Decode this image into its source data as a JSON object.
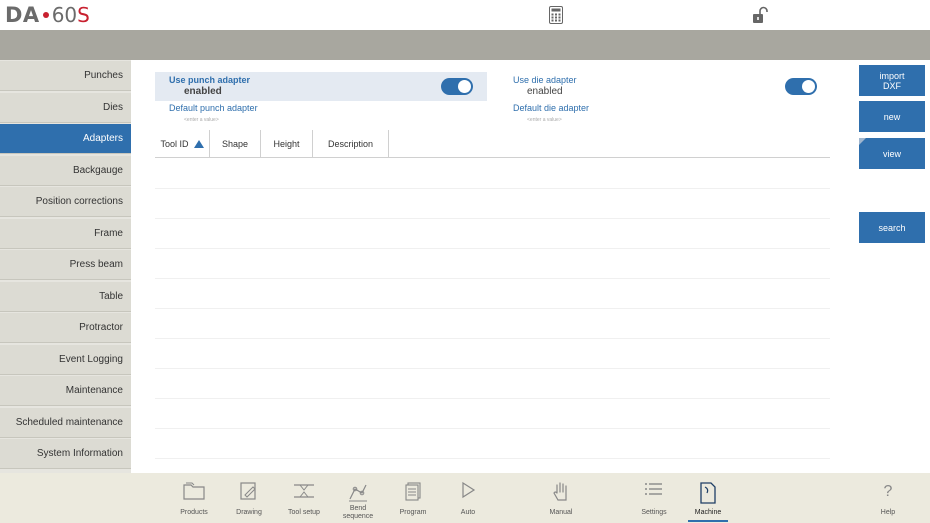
{
  "header": {
    "logo_brand": "DA",
    "logo_model_prefix": "60",
    "logo_model_suffix": "S"
  },
  "sidebar": {
    "items": [
      {
        "label": "Punches",
        "active": false
      },
      {
        "label": "Dies",
        "active": false
      },
      {
        "label": "Adapters",
        "active": true
      },
      {
        "label": "Backgauge",
        "active": false
      },
      {
        "label": "Position corrections",
        "active": false
      },
      {
        "label": "Frame",
        "active": false
      },
      {
        "label": "Press beam",
        "active": false
      },
      {
        "label": "Table",
        "active": false
      },
      {
        "label": "Protractor",
        "active": false
      },
      {
        "label": "Event Logging",
        "active": false
      },
      {
        "label": "Maintenance",
        "active": false
      },
      {
        "label": "Scheduled maintenance",
        "active": false
      },
      {
        "label": "System Information",
        "active": false
      }
    ]
  },
  "options": {
    "use_punch_adapter": {
      "label": "Use punch adapter",
      "value": "enabled",
      "toggle_on": true
    },
    "use_die_adapter": {
      "label": "Use die adapter",
      "value": "enabled",
      "toggle_on": true
    },
    "default_punch_adapter": {
      "label": "Default punch adapter",
      "placeholder": "<enter a value>"
    },
    "default_die_adapter": {
      "label": "Default die adapter",
      "placeholder": "<enter a value>"
    }
  },
  "table": {
    "columns": [
      "Tool ID",
      "Shape",
      "Height",
      "Description"
    ],
    "sort_column": "Tool ID",
    "sort_direction": "ascending",
    "rows": []
  },
  "actions": {
    "import_dxf": "import\nDXF",
    "new": "new",
    "view": "view",
    "search": "search"
  },
  "bottom_nav": [
    {
      "label": "Products",
      "icon": "folder-icon",
      "active": false
    },
    {
      "label": "Drawing",
      "icon": "pencil-icon",
      "active": false
    },
    {
      "label": "Tool setup",
      "icon": "tool-setup-icon",
      "active": false
    },
    {
      "label": "Bend\nsequence",
      "icon": "bend-sequence-icon",
      "active": false
    },
    {
      "label": "Program",
      "icon": "program-icon",
      "active": false
    },
    {
      "label": "Auto",
      "icon": "play-icon",
      "active": false
    },
    {
      "label": "Manual",
      "icon": "hand-icon",
      "active": false
    },
    {
      "label": "Settings",
      "icon": "settings-list-icon",
      "active": false
    },
    {
      "label": "Machine",
      "icon": "machine-icon",
      "active": true
    },
    {
      "label": "Help",
      "icon": "help-icon",
      "active": false
    }
  ],
  "colors": {
    "accent": "#2f6fad",
    "brand_red": "#c8202f",
    "sidebar_bg": "#dcdbd3",
    "band_gray": "#a8a79f",
    "bottom_bg": "#eceade"
  }
}
